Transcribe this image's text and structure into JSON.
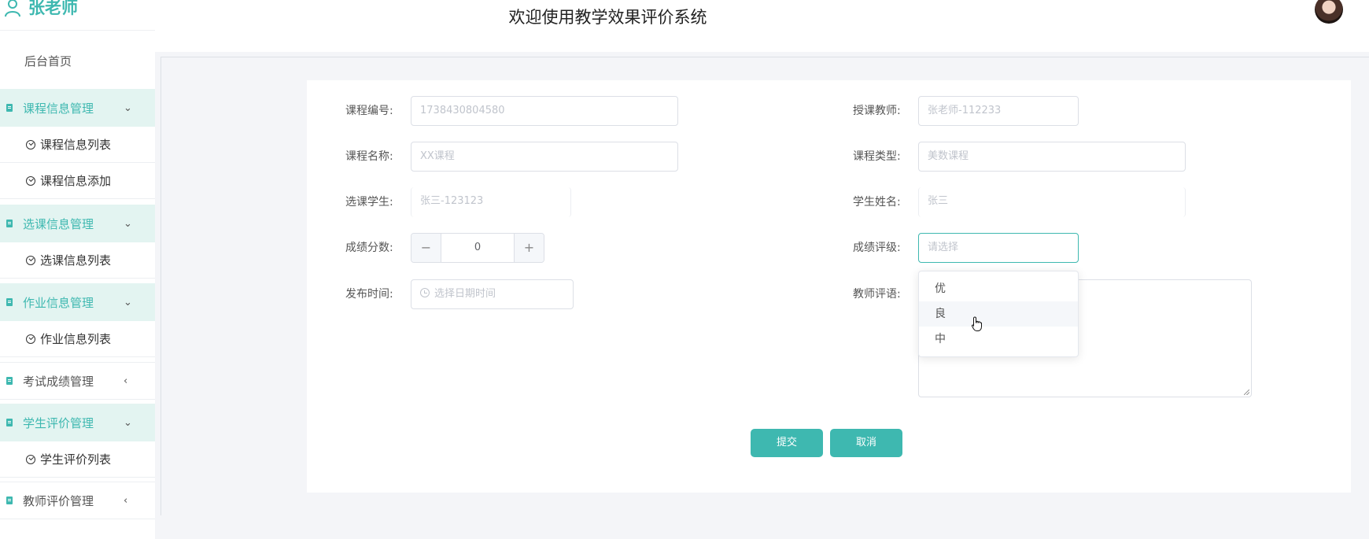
{
  "header": {
    "username": "张老师",
    "title": "欢迎使用教学效果评价系统"
  },
  "sidebar": {
    "home": "后台首页",
    "groups": [
      {
        "label": "课程信息管理",
        "arrow": "⌄",
        "items": [
          "课程信息列表",
          "课程信息添加"
        ]
      },
      {
        "label": "选课信息管理",
        "arrow": "⌄",
        "items": [
          "选课信息列表"
        ]
      },
      {
        "label": "作业信息管理",
        "arrow": "⌄",
        "items": [
          "作业信息列表"
        ]
      },
      {
        "label": "考试成绩管理",
        "arrow": "‹",
        "items": []
      },
      {
        "label": "学生评价管理",
        "arrow": "⌄",
        "items": [
          "学生评价列表"
        ]
      },
      {
        "label": "教师评价管理",
        "arrow": "‹",
        "items": []
      }
    ]
  },
  "form": {
    "course_no": {
      "label": "课程编号:",
      "value": "1738430804580"
    },
    "teacher": {
      "label": "授课教师:",
      "value": "张老师-112233"
    },
    "course_name": {
      "label": "课程名称:",
      "value": "XX课程"
    },
    "course_type": {
      "label": "课程类型:",
      "value": "美数课程"
    },
    "student": {
      "label": "选课学生:",
      "value": "张三-123123"
    },
    "student_name": {
      "label": "学生姓名:",
      "value": "张三"
    },
    "score": {
      "label": "成绩分数:",
      "value": "0",
      "minus": "−",
      "plus": "+"
    },
    "grade": {
      "label": "成绩评级:",
      "placeholder": "请选择",
      "options": [
        "优",
        "良",
        "中"
      ]
    },
    "publish_time": {
      "label": "发布时间:",
      "placeholder": "选择日期时间"
    },
    "comment": {
      "label": "教师评语:"
    }
  },
  "buttons": {
    "submit": "提交",
    "cancel": "取消"
  },
  "colors": {
    "accent": "#3eb8b0",
    "sidebar_group_bg": "#e3f4f1",
    "content_bg": "#f4f5f8"
  }
}
